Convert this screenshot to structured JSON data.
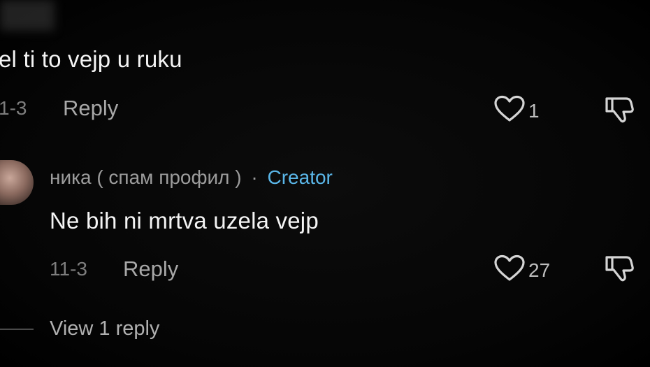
{
  "comments": [
    {
      "text": "el ti to vejp u ruku",
      "date": "1-3",
      "reply_label": "Reply",
      "like_count": "1"
    },
    {
      "author": "ника ( спам профил )",
      "separator": "·",
      "badge": "Creator",
      "text": "Ne bih ni mrtva uzela vejp",
      "date": "11-3",
      "reply_label": "Reply",
      "like_count": "27"
    }
  ],
  "view_replies_label": "View 1 reply",
  "colors": {
    "background": "#000000",
    "creator_badge": "#5ab6e8",
    "muted_text": "#9c9c9c"
  },
  "icons": [
    "heart-icon",
    "dislike-icon"
  ]
}
